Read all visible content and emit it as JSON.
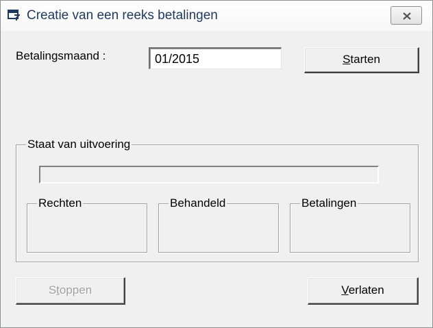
{
  "window": {
    "title": "Creatie van een reeks betalingen",
    "app_icon": "window-app-icon",
    "close_icon": "close-icon"
  },
  "form": {
    "month_label": "Betalingsmaand :",
    "month_value": "01/2015",
    "start_label_mnemonic": "S",
    "start_label_rest": "tarten"
  },
  "execution": {
    "group_label": "Staat van uitvoering",
    "progress_fraction": 0,
    "counters": [
      {
        "label": "Rechten",
        "value": ""
      },
      {
        "label": "Behandeld",
        "value": ""
      },
      {
        "label": "Betalingen",
        "value": ""
      }
    ]
  },
  "footer": {
    "stop_label_pre": "S",
    "stop_label_mnemonic": "t",
    "stop_label_post": "oppen",
    "stop_enabled": false,
    "quit_label_mnemonic": "V",
    "quit_label_rest": "erlaten"
  }
}
